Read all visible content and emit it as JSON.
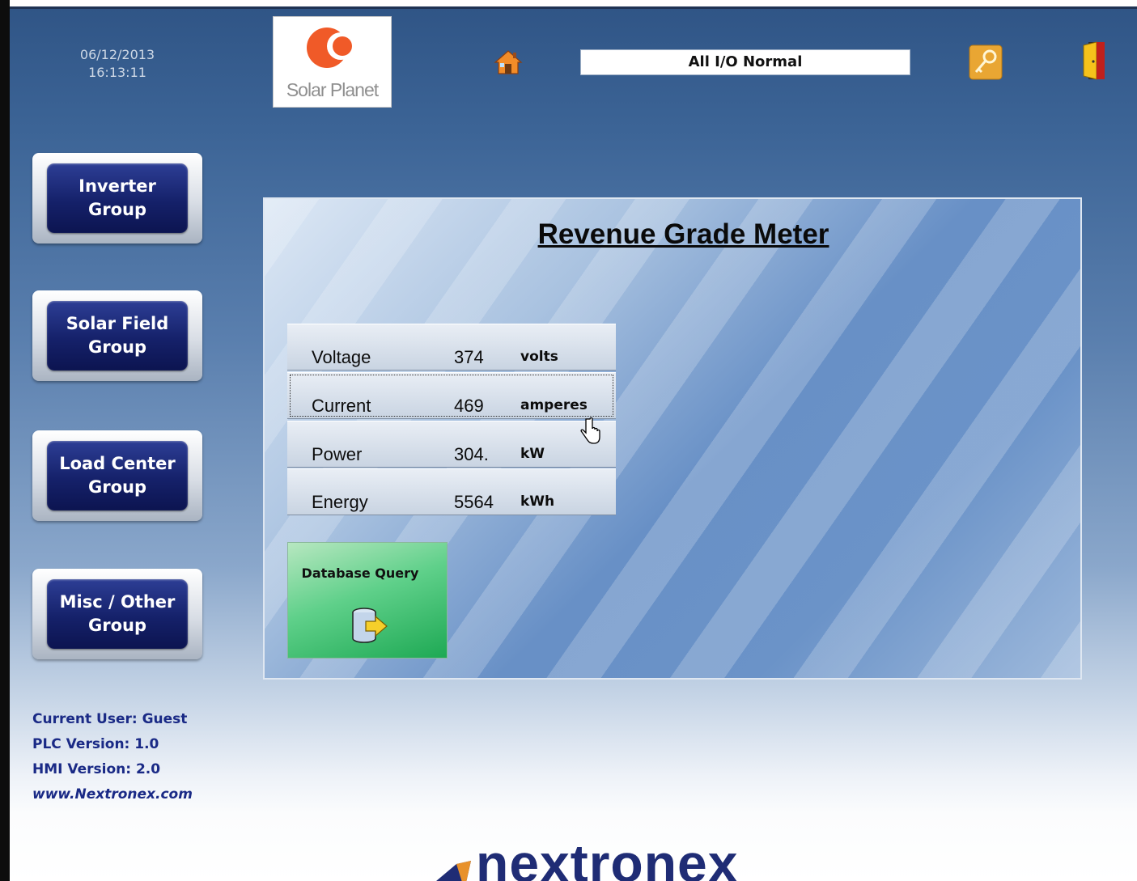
{
  "header": {
    "date": "06/12/2013",
    "time": "16:13:11",
    "logo_text": "Solar Planet",
    "status": "All I/O Normal"
  },
  "icons": {
    "home": "home-icon",
    "security": "key-icon",
    "exit": "exit-door-icon",
    "database": "database-icon",
    "cursor": "hand-pointer-icon"
  },
  "nav": {
    "items": [
      {
        "line1": "Inverter",
        "line2": "Group"
      },
      {
        "line1": "Solar Field",
        "line2": "Group"
      },
      {
        "line1": "Load Center",
        "line2": "Group"
      },
      {
        "line1": "Misc / Other",
        "line2": "Group"
      }
    ]
  },
  "panel": {
    "title": "Revenue Grade Meter",
    "rows": [
      {
        "label": "Voltage",
        "value": "374",
        "unit": "volts"
      },
      {
        "label": "Current",
        "value": "469",
        "unit": "amperes"
      },
      {
        "label": "Power",
        "value": "304.",
        "unit": "kW"
      },
      {
        "label": "Energy",
        "value": "5564",
        "unit": "kWh"
      }
    ],
    "db_button": "Database Query"
  },
  "info": {
    "user": "Current User: Guest",
    "plc": "PLC Version: 1.0",
    "hmi": "HMI Version: 2.0",
    "website": "www.Nextronex.com"
  },
  "footer": {
    "brand": "nextronex"
  },
  "colors": {
    "accent": "#15216a",
    "background": "#3c6496",
    "db_button": "#1ea954",
    "logo_mark": "#f05a28"
  }
}
